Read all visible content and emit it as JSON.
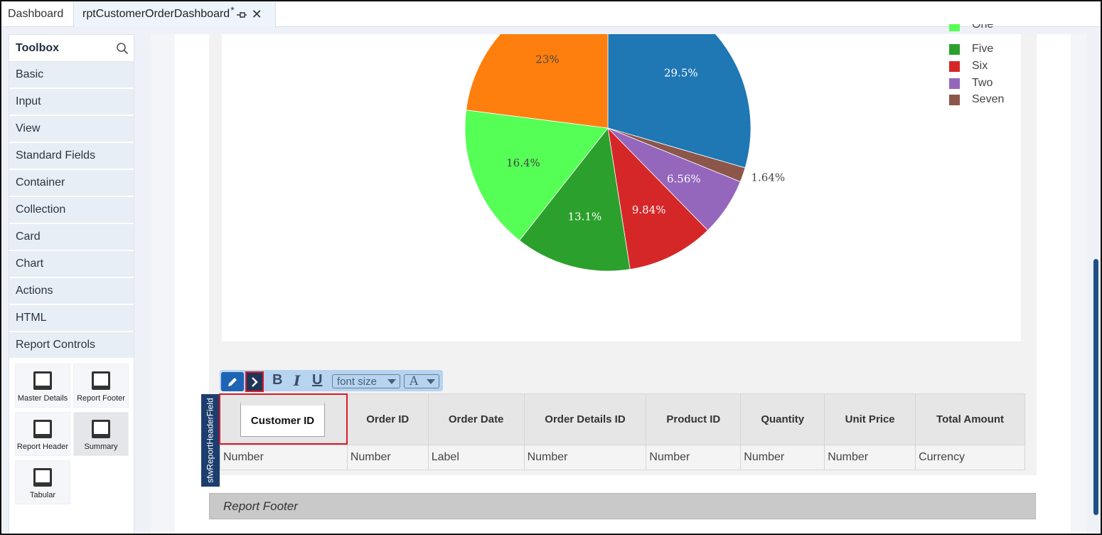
{
  "tabs": {
    "dashboard": "Dashboard",
    "report": "rptCustomerOrderDashboard",
    "modified": "*"
  },
  "toolbox": {
    "title": "Toolbox",
    "items": [
      "Basic",
      "Input",
      "View",
      "Standard Fields",
      "Container",
      "Collection",
      "Card",
      "Chart",
      "Actions",
      "HTML",
      "Report Controls"
    ],
    "report_controls": [
      "Master Details",
      "Report Footer",
      "Report Header",
      "Summary",
      "Tabular"
    ]
  },
  "chart_data": {
    "type": "pie",
    "slices": [
      {
        "label": "",
        "value": 29.5,
        "text": "29.5%",
        "color": "#1f77b4"
      },
      {
        "label": "Seven",
        "value": 1.64,
        "text": "1.64%",
        "color": "#8c564b"
      },
      {
        "label": "Two",
        "value": 6.56,
        "text": "6.56%",
        "color": "#9467bd"
      },
      {
        "label": "Six",
        "value": 9.84,
        "text": "9.84%",
        "color": "#d62728"
      },
      {
        "label": "Five",
        "value": 13.1,
        "text": "13.1%",
        "color": "#2ca02c"
      },
      {
        "label": "One",
        "value": 16.4,
        "text": "16.4%",
        "color": "#55ff55"
      },
      {
        "label": "",
        "value": 23,
        "text": "23%",
        "color": "#ff7f0e"
      }
    ],
    "legend_visible": [
      "Five",
      "Six",
      "Two",
      "Seven"
    ],
    "legend_partial": "One",
    "legend_placement": "top-right"
  },
  "text_toolbar": {
    "bold": "B",
    "italic": "I",
    "underline": "U",
    "font_size": "font size",
    "color": "A"
  },
  "header_field_label": "sfwReportHeaderField",
  "table": {
    "headers": [
      "Customer ID",
      "Order ID",
      "Order Date",
      "Order Details ID",
      "Product ID",
      "Quantity",
      "Unit Price",
      "Total Amount"
    ],
    "types": [
      "Number",
      "Number",
      "Label",
      "Number",
      "Number",
      "Number",
      "Number",
      "Currency"
    ]
  },
  "report_footer": "Report Footer"
}
